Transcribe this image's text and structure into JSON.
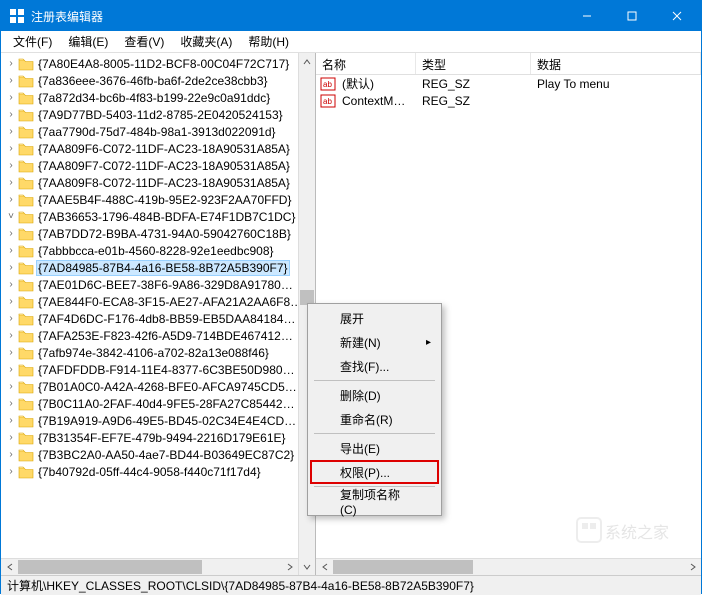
{
  "window": {
    "title": "注册表编辑器"
  },
  "menu": {
    "file": "文件(F)",
    "edit": "编辑(E)",
    "view": "查看(V)",
    "fav": "收藏夹(A)",
    "help": "帮助(H)"
  },
  "tree": {
    "items": [
      "{7A80E4A8-8005-11D2-BCF8-00C04F72C717}",
      "{7a836eee-3676-46fb-ba6f-2de2ce38cbb3}",
      "{7a872d34-bc6b-4f83-b199-22e9c0a91ddc}",
      "{7A9D77BD-5403-11d2-8785-2E0420524153}",
      "{7aa7790d-75d7-484b-98a1-3913d022091d}",
      "{7AA809F6-C072-11DF-AC23-18A90531A85A}",
      "{7AA809F7-C072-11DF-AC23-18A90531A85A}",
      "{7AA809F8-C072-11DF-AC23-18A90531A85A}",
      "{7AAE5B4F-488C-419b-95E2-923F2AA70FFD}",
      "{7AB36653-1796-484B-BDFA-E74F1DB7C1DC}",
      "{7AB7DD72-B9BA-4731-94A0-59042760C18B}",
      "{7abbbcca-e01b-4560-8228-92e1eedbc908}",
      "{7AD84985-87B4-4a16-BE58-8B72A5B390F7}",
      "{7AE01D6C-BEE7-38F6-9A86-329D8A91780…",
      "{7AE844F0-ECA8-3F15-AE27-AFA21A2AA6F8…",
      "{7AF4D6DC-F176-4db8-BB59-EB5DAA84184…",
      "{7AFA253E-F823-42f6-A5D9-714BDE467412…",
      "{7afb974e-3842-4106-a702-82a13e088f46}",
      "{7AFDFDDB-F914-11E4-8377-6C3BE50D980…",
      "{7B01A0C0-A42A-4268-BFE0-AFCA9745CD5…",
      "{7B0C11A0-2FAF-40d4-9FE5-28FA27C85442…",
      "{7B19A919-A9D6-49E5-BD45-02C34E4E4CD…",
      "{7B31354F-EF7E-479b-9494-2216D179E61E}",
      "{7B3BC2A0-AA50-4ae7-BD44-B03649EC87C2}",
      "{7b40792d-05ff-44c4-9058-f440c71f17d4}"
    ],
    "selected_index": 12
  },
  "list": {
    "cols": {
      "name": "名称",
      "type": "类型",
      "data": "数据"
    },
    "rows": [
      {
        "name": "(默认)",
        "type": "REG_SZ",
        "data": "Play To menu",
        "icon": "string"
      },
      {
        "name": "ContextMenu...",
        "type": "REG_SZ",
        "data": "",
        "icon": "string"
      }
    ]
  },
  "context_menu": {
    "expand": "展开",
    "new": "新建(N)",
    "find": "查找(F)...",
    "delete": "删除(D)",
    "rename": "重命名(R)",
    "export": "导出(E)",
    "perm": "权限(P)...",
    "copykey": "复制项名称(C)"
  },
  "status": {
    "path": "计算机\\HKEY_CLASSES_ROOT\\CLSID\\{7AD84985-87B4-4a16-BE58-8B72A5B390F7}"
  },
  "watermark": "系统之家"
}
